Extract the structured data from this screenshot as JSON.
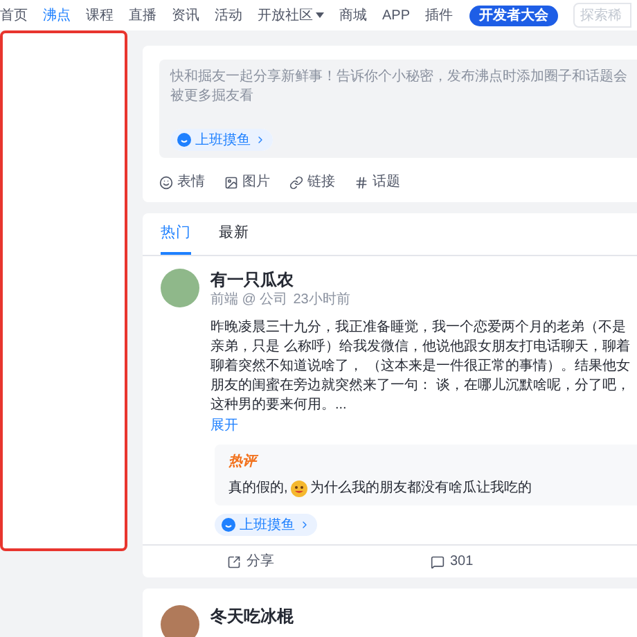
{
  "nav": {
    "items": [
      {
        "label": "首页",
        "selected": false,
        "dropdown": false
      },
      {
        "label": "沸点",
        "selected": true,
        "dropdown": false
      },
      {
        "label": "课程",
        "selected": false,
        "dropdown": false
      },
      {
        "label": "直播",
        "selected": false,
        "dropdown": false
      },
      {
        "label": "资讯",
        "selected": false,
        "dropdown": false
      },
      {
        "label": "活动",
        "selected": false,
        "dropdown": false
      },
      {
        "label": "开放社区",
        "selected": false,
        "dropdown": true
      },
      {
        "label": "商城",
        "selected": false,
        "dropdown": false
      },
      {
        "label": "APP",
        "selected": false,
        "dropdown": false
      },
      {
        "label": "插件",
        "selected": false,
        "dropdown": false
      }
    ],
    "event_button": "开发者大会",
    "search": {
      "placeholder": "探索稀"
    }
  },
  "composer": {
    "placeholder": "快和掘友一起分享新鲜事！告诉你个小秘密，发布沸点时添加圈子和话题会被更多掘友看",
    "circle_tag": "上班摸鱼",
    "tools": [
      {
        "kind": "emoji",
        "label": "表情"
      },
      {
        "kind": "image",
        "label": "图片"
      },
      {
        "kind": "link",
        "label": "链接"
      },
      {
        "kind": "topic",
        "label": "话题"
      }
    ]
  },
  "feed_tabs": [
    {
      "label": "热门",
      "selected": true
    },
    {
      "label": "最新",
      "selected": false
    }
  ],
  "posts": [
    {
      "author": "有一只瓜农",
      "role": "前端 @ 公司",
      "time": "23小时前",
      "text": "昨晚凌晨三十九分，我正准备睡觉，我一个恋爱两个月的老弟（不是亲弟，只是 么称呼）给我发微信，他说他跟女朋友打电话聊天，聊着聊着突然不知道说啥了， （这本来是一件很正常的事情）。结果他女朋友的闺蜜在旁边就突然来了一句： 谈，在哪儿沉默啥呢，分了吧，这种男的要来何用。...",
      "expand": "展开",
      "hot_comment": {
        "badge": "热评",
        "before": "真的假的,",
        "after": "为什么我的朋友都没有啥瓜让我吃的"
      },
      "tag": "上班摸鱼",
      "share": "分享",
      "comments": "301"
    },
    {
      "author": "冬天吃冰棍"
    }
  ]
}
